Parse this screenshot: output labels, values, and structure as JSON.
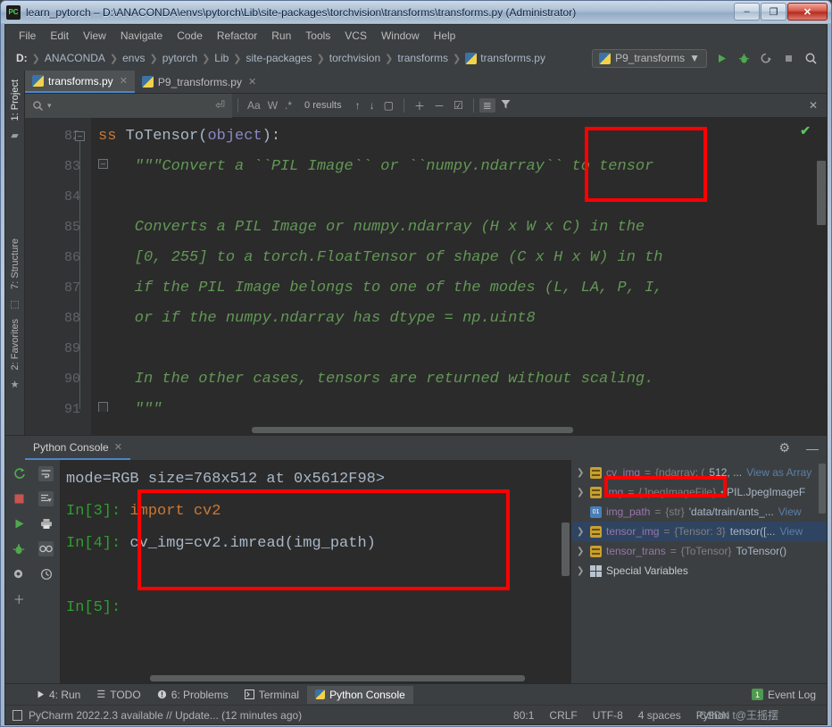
{
  "window": {
    "title": "learn_pytorch – D:\\ANACONDA\\envs\\pytorch\\Lib\\site-packages\\torchvision\\transforms\\transforms.py (Administrator)",
    "logo": "pycharm-logo",
    "minimize": "–",
    "maximize": "❐",
    "close": "✕"
  },
  "menu": {
    "items": [
      {
        "label": "File"
      },
      {
        "label": "Edit"
      },
      {
        "label": "View"
      },
      {
        "label": "Navigate"
      },
      {
        "label": "Code"
      },
      {
        "label": "Refactor"
      },
      {
        "label": "Run"
      },
      {
        "label": "Tools"
      },
      {
        "label": "VCS"
      },
      {
        "label": "Window"
      },
      {
        "label": "Help"
      }
    ]
  },
  "breadcrumb": {
    "items": [
      {
        "label": "D:"
      },
      {
        "label": "ANACONDA"
      },
      {
        "label": "envs"
      },
      {
        "label": "pytorch"
      },
      {
        "label": "Lib"
      },
      {
        "label": "site-packages"
      },
      {
        "label": "torchvision"
      },
      {
        "label": "transforms"
      },
      {
        "label": "transforms.py"
      }
    ],
    "separator": "❯"
  },
  "run_config": {
    "name": "P9_transforms",
    "dropdown_caret": "▼",
    "run_icon": "run-icon",
    "debug_icon": "debug-icon",
    "coverage_icon": "run-with-coverage-icon",
    "stop_icon": "stop-icon",
    "search_icon": "search-everywhere-icon"
  },
  "left_strip": {
    "project": "1: Project",
    "structure": "7: Structure",
    "favorites": "2: Favorites"
  },
  "editor_tabs": [
    {
      "label": "transforms.py",
      "active": true,
      "close": "✕"
    },
    {
      "label": "P9_transforms.py",
      "active": false,
      "close": "✕"
    }
  ],
  "find_bar": {
    "placeholder": "",
    "search_icon": "search-icon",
    "dropdown_caret": "▾",
    "newline_icon": "⏎",
    "match_case": "Aa",
    "words": "W",
    "regex": ".*",
    "results": "0 results",
    "prev_icon": "↑",
    "next_icon": "↓",
    "select_all_icon": "▢",
    "add_icon": "＋",
    "remove_icon": "－",
    "check_icon": "☑",
    "filter_list_icon": "≣",
    "filter_icon": "▼",
    "close_icon": "✕"
  },
  "code": {
    "lines": [
      {
        "num": "82",
        "segments": [
          {
            "t": "ss ",
            "c": "kw"
          },
          {
            "t": "ToTensor",
            "c": "cls"
          },
          {
            "t": "(",
            "c": "cls"
          },
          {
            "t": "object",
            "c": "builtin"
          },
          {
            "t": "):",
            "c": "cls"
          }
        ]
      },
      {
        "num": "83",
        "segments": [
          {
            "t": "    \"\"\"Convert a ``PIL Image`` or ``numpy.ndarray`` to tensor",
            "c": "doc"
          }
        ]
      },
      {
        "num": "84",
        "segments": [
          {
            "t": "",
            "c": "doc"
          }
        ]
      },
      {
        "num": "85",
        "segments": [
          {
            "t": "    Converts a PIL Image or numpy.ndarray (H x W x C) in the ",
            "c": "doc"
          }
        ]
      },
      {
        "num": "86",
        "segments": [
          {
            "t": "    [0, 255] to a torch.FloatTensor of shape (C x H x W) in th",
            "c": "doc"
          }
        ]
      },
      {
        "num": "87",
        "segments": [
          {
            "t": "    if the PIL Image belongs to one of the modes (L, LA, P, I,",
            "c": "doc"
          }
        ]
      },
      {
        "num": "88",
        "segments": [
          {
            "t": "    or if the numpy.ndarray has dtype = np.uint8",
            "c": "doc"
          }
        ]
      },
      {
        "num": "89",
        "segments": [
          {
            "t": "",
            "c": "doc"
          }
        ]
      },
      {
        "num": "90",
        "segments": [
          {
            "t": "    In the other cases, tensors are returned without scaling.",
            "c": "doc"
          }
        ]
      },
      {
        "num": "91",
        "segments": [
          {
            "t": "    \"\"\"",
            "c": "doc"
          }
        ]
      }
    ],
    "inspection_ok": "✔"
  },
  "console": {
    "tab_label": "Python Console",
    "tab_close": "✕",
    "settings_icon": "gear-icon",
    "minimize_icon": "minimize-icon",
    "toolbar": {
      "rerun_icon": "rerun-icon",
      "stop_icon": "stop-icon",
      "execute_icon": "execute-icon",
      "debug_icon": "debug-icon",
      "settings_icon": "settings-icon",
      "add_icon": "add-icon",
      "soft_wrap_icon": "soft-wrap-icon",
      "scroll_end_icon": "scroll-to-end-icon",
      "print_icon": "print-icon",
      "show_vars_icon": "show-variables-icon",
      "history_icon": "history-icon"
    },
    "lines": [
      {
        "prompt": "",
        "text": "mode=RGB size=768x512 at 0x5612F98>"
      },
      {
        "prompt": "In[3]:",
        "text": "import cv2",
        "kw": "import"
      },
      {
        "prompt": "In[4]:",
        "text": "cv_img=cv2.imread(img_path)"
      },
      {
        "prompt": "",
        "text": ""
      },
      {
        "prompt": "In[5]:",
        "text": ""
      }
    ]
  },
  "variables": {
    "rows": [
      {
        "arrow": "❯",
        "icon": "collection-icon",
        "name": "cv_img",
        "eq": " = ",
        "type": "{ndarray: (",
        "value": "512, ...",
        "link": "View as Array",
        "selected": false
      },
      {
        "arrow": "❯",
        "icon": "collection-icon",
        "name": "img",
        "eq": " = ",
        "type": "{JpegImageFile}",
        "value": " <PIL.JpegImageF",
        "link": "",
        "selected": false
      },
      {
        "arrow": "",
        "icon": "string-icon",
        "name": "img_path",
        "eq": " = ",
        "type": "{str}",
        "value": " 'data/train/ants_...",
        "link": " View",
        "selected": false
      },
      {
        "arrow": "❯",
        "icon": "collection-icon",
        "name": "tensor_img",
        "eq": " = ",
        "type": "{Tensor: 3}",
        "value": " tensor([...",
        "link": " View",
        "selected": true
      },
      {
        "arrow": "❯",
        "icon": "collection-icon",
        "name": "tensor_trans",
        "eq": " = ",
        "type": "{ToTensor}",
        "value": " ToTensor()",
        "link": "",
        "selected": false
      },
      {
        "arrow": "❯",
        "icon": "special-icon",
        "name": "Special Variables",
        "eq": "",
        "type": "",
        "value": "",
        "link": "",
        "selected": false
      }
    ]
  },
  "bottom_tools": [
    {
      "label": "4: Run",
      "icon": "run-icon",
      "active": false
    },
    {
      "label": "TODO",
      "icon": "todo-icon",
      "active": false
    },
    {
      "label": "6: Problems",
      "icon": "problems-icon",
      "active": false
    },
    {
      "label": "Terminal",
      "icon": "terminal-icon",
      "active": false
    },
    {
      "label": "Python Console",
      "icon": "python-console-icon",
      "active": true
    }
  ],
  "event_log": {
    "count": "1",
    "label": "Event Log"
  },
  "status": {
    "update_icon": "update-icon",
    "message": "PyCharm 2022.2.3 available // Update... (12 minutes ago)",
    "caret": "80:1",
    "line_sep": "CRLF",
    "encoding": "UTF-8",
    "indent": "4 spaces",
    "interpreter": "Python",
    "watermark": "CSDN t@王摇摆"
  },
  "annotations": {
    "box_ndarray": "ndarray-highlight-box",
    "box_console": "console-code-highlight-box",
    "box_cvimg": "cv-img-variable-highlight-box",
    "color": "#ff0000"
  }
}
